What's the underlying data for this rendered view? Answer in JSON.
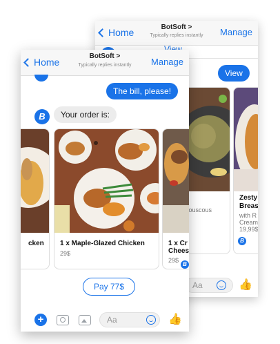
{
  "back_phone": {
    "nav": {
      "back_label": "Home",
      "title": "BotSoft >",
      "subtitle": "Typically replies instantly",
      "manage_label": "Manage"
    },
    "view_link": "View",
    "view_button": "View",
    "cards": [
      {
        "title": "",
        "subtitle": "Couscous"
      },
      {
        "title": "Zesty",
        "title2": "Breas",
        "subtitle": "with R",
        "subtitle2": "Cream",
        "price": "19,99$"
      }
    ],
    "composer": {
      "placeholder": "Aa"
    }
  },
  "front_phone": {
    "nav": {
      "back_label": "Home",
      "title": "BotSoft >",
      "subtitle": "Typically replies instantly",
      "manage_label": "Manage"
    },
    "messages": {
      "user": "The bill, please!",
      "bot": "Your order is:"
    },
    "bot_initial": "B",
    "cards": [
      {
        "title": "cken",
        "price": ""
      },
      {
        "title": "1 x Maple-Glazed Chicken",
        "price": "29$"
      },
      {
        "title": "1 x Cr",
        "title2": "Chees",
        "price": "29$"
      }
    ],
    "pay_button": "Pay 77$",
    "composer": {
      "placeholder": "Aa"
    }
  },
  "colors": {
    "accent": "#1a73e8",
    "bubble_gray": "#ececec"
  }
}
